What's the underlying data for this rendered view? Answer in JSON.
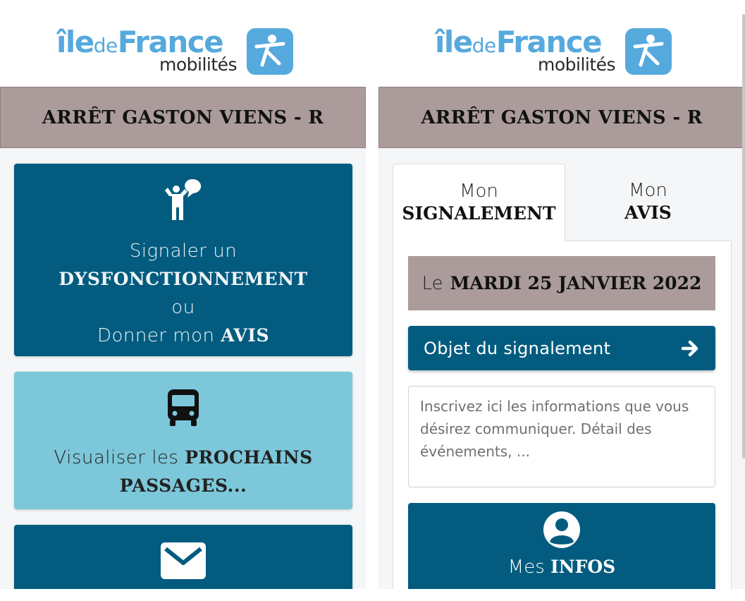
{
  "brand": {
    "ile": "îlede",
    "de": "de",
    "france": "France",
    "mobilites": "mobilités"
  },
  "stop": {
    "title": "ARRÊT GASTON VIENS - R"
  },
  "left": {
    "report_card": {
      "line1": "Signaler un",
      "line2": "DYSFONCTIONNEMENT",
      "line3": "ou",
      "line4_prefix": "Donner mon",
      "line4_bold": "AVIS"
    },
    "next_card": {
      "prefix": "Visualiser les",
      "bold1": "PROCHAINS",
      "bold2": "PASSAGES..."
    }
  },
  "right": {
    "tabs": [
      {
        "top": "Mon",
        "bottom": "SIGNALEMENT"
      },
      {
        "top": "Mon",
        "bottom": "AVIS"
      }
    ],
    "date": {
      "prefix": "Le",
      "value": "MARDI 25 JANVIER 2022"
    },
    "objet_label": "Objet du signalement",
    "textarea_placeholder": "Inscrivez ici les informations que vous désirez communiquer. Détail des événements, ...",
    "infos": {
      "prefix": "Mes",
      "bold": "INFOS"
    }
  },
  "colors": {
    "dark_teal": "#035c7f",
    "light_teal": "#7cc7d9",
    "taupe": "#ab9b9b",
    "logo_blue": "#56a9dd"
  },
  "icons": [
    "person-speech-icon",
    "bus-icon",
    "mail-icon",
    "arrow-right-icon",
    "user-icon"
  ]
}
